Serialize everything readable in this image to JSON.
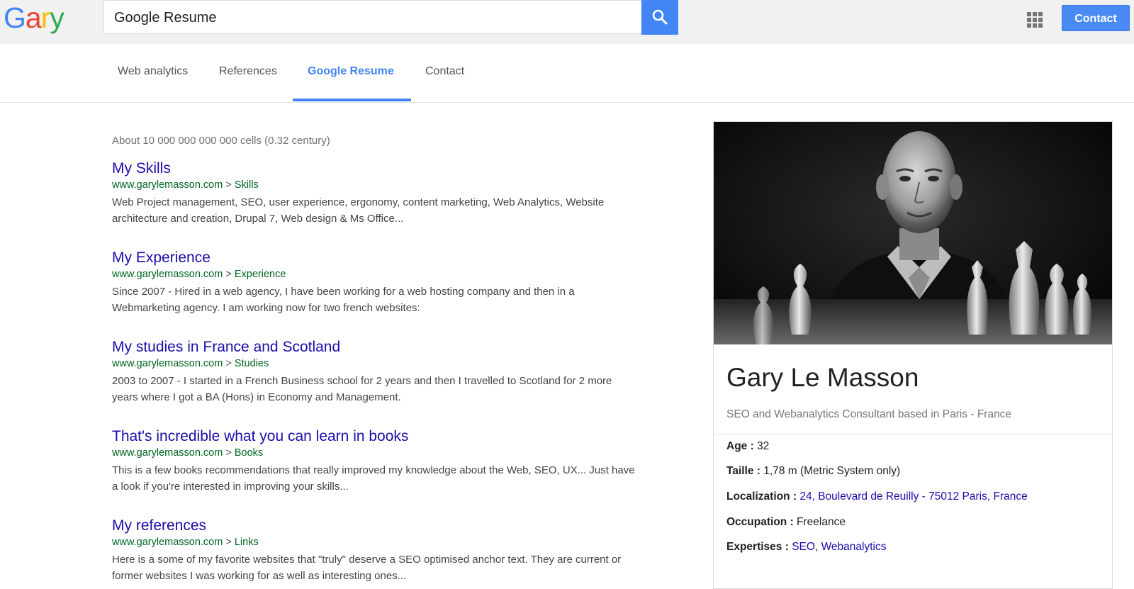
{
  "brand": {
    "letters": [
      {
        "char": "G",
        "color": "#4285f4"
      },
      {
        "char": "a",
        "color": "#ea4335"
      },
      {
        "char": "r",
        "color": "#fbbc05"
      },
      {
        "char": "y",
        "color": "#34a853"
      }
    ]
  },
  "search": {
    "value": "Google Resume",
    "icon": "search-icon"
  },
  "header": {
    "apps_icon": "apps-grid-icon",
    "contact_label": "Contact"
  },
  "tabs": [
    {
      "label": "Web analytics",
      "active": false
    },
    {
      "label": "References",
      "active": false
    },
    {
      "label": "Google Resume",
      "active": true
    },
    {
      "label": "Contact",
      "active": false
    }
  ],
  "results_count": "About 10 000 000 000 000 cells (0.32 century)",
  "results": [
    {
      "title": "My Skills",
      "domain": "www.garylemasson.com",
      "separator": ">",
      "section": "Skills",
      "snippet_lines": [
        "Web Project management, SEO, user experience, ergonomy, content marketing, Web Analytics, Website",
        "architecture and creation, Drupal 7, Web design & Ms Office..."
      ]
    },
    {
      "title": "My Experience",
      "domain": "www.garylemasson.com",
      "separator": ">",
      "section": "Experience",
      "snippet_lines": [
        "Since 2007 - Hired in a web agency, I have been working for a web hosting company and then in a",
        "Webmarketing agency. I am working now for two french websites:"
      ]
    },
    {
      "title": "My studies in France and Scotland",
      "domain": "www.garylemasson.com",
      "separator": ">",
      "section": "Studies",
      "snippet_lines": [
        "2003 to 2007 - I started in a French Business school for 2 years and then I travelled to Scotland for 2 more",
        "years where I got a BA (Hons) in Economy and Management."
      ]
    },
    {
      "title": "That's incredible what you can learn in books",
      "domain": "www.garylemasson.com",
      "separator": ">",
      "section": "Books",
      "snippet_lines": [
        "This is a few books recommendations that really improved my knowledge about the Web, SEO, UX... Just have",
        "a look if you're interested in improving your skills..."
      ]
    },
    {
      "title": "My references",
      "domain": "www.garylemasson.com",
      "separator": ">",
      "section": "Links",
      "snippet_lines": [
        "Here is a some of my favorite websites that \"truly\" deserve a SEO optimised anchor text. They are current or",
        "former websites I was working for as well as interesting ones..."
      ]
    }
  ],
  "knowledge_panel": {
    "name": "Gary Le Masson",
    "description": "SEO and Webanalytics Consultant based in Paris - France",
    "facts": {
      "age": {
        "label": "Age :",
        "value": "32"
      },
      "taille": {
        "label": "Taille :",
        "value": "1,78 m (Metric System only)"
      },
      "localization": {
        "label": "Localization :",
        "value": "24, Boulevard de Reuilly - 75012 Paris, France"
      },
      "occupation": {
        "label": "Occupation :",
        "value": "Freelance"
      },
      "expertises": {
        "label": "Expertises :",
        "links": [
          "SEO",
          "Webanalytics"
        ],
        "separator": ","
      }
    }
  }
}
